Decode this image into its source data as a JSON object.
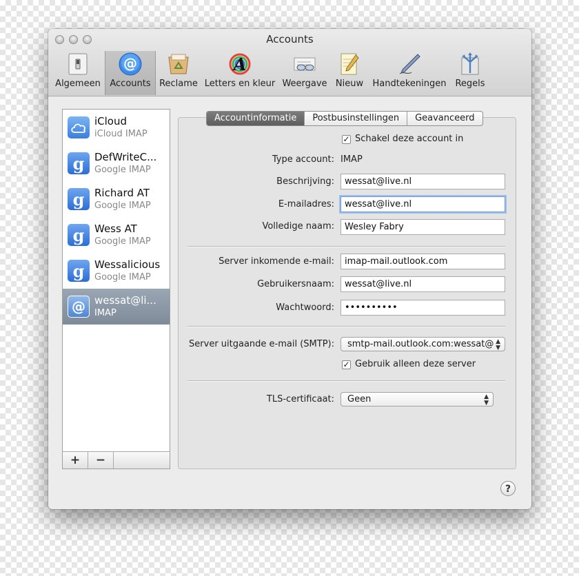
{
  "window": {
    "title": "Accounts"
  },
  "toolbar": [
    {
      "label": "Algemeen",
      "icon": "switch-icon"
    },
    {
      "label": "Accounts",
      "icon": "at-icon"
    },
    {
      "label": "Reclame",
      "icon": "recycle-icon"
    },
    {
      "label": "Letters en kleur",
      "icon": "font-color-icon"
    },
    {
      "label": "Weergave",
      "icon": "glasses-icon"
    },
    {
      "label": "Nieuw",
      "icon": "notepad-icon"
    },
    {
      "label": "Handtekeningen",
      "icon": "pen-icon"
    },
    {
      "label": "Regels",
      "icon": "rules-icon"
    }
  ],
  "accounts": [
    {
      "name": "iCloud",
      "type": "iCloud IMAP",
      "icon": "cloud-icon"
    },
    {
      "name": "DefWriteC...",
      "type": "Google IMAP",
      "icon": "google-icon"
    },
    {
      "name": "Richard AT",
      "type": "Google IMAP",
      "icon": "google-icon"
    },
    {
      "name": "Wess AT",
      "type": "Google IMAP",
      "icon": "google-icon"
    },
    {
      "name": "Wessalicious",
      "type": "Google IMAP",
      "icon": "google-icon"
    },
    {
      "name": "wessat@li...",
      "type": "IMAP",
      "icon": "at-icon"
    }
  ],
  "sidebar_buttons": {
    "add": "+",
    "remove": "−"
  },
  "tabs": [
    "Accountinformatie",
    "Postbusinstellingen",
    "Geavanceerd"
  ],
  "form": {
    "enable_label": "Schakel deze account in",
    "type_label": "Type account:",
    "type_value": "IMAP",
    "description_label": "Beschrijving:",
    "description_value": "wessat@live.nl",
    "email_label": "E-mailadres:",
    "email_value": "wessat@live.nl",
    "fullname_label": "Volledige naam:",
    "fullname_value": "Wesley Fabry",
    "incoming_label": "Server inkomende e-mail:",
    "incoming_value": "imap-mail.outlook.com",
    "username_label": "Gebruikersnaam:",
    "username_value": "wessat@live.nl",
    "password_label": "Wachtwoord:",
    "password_value": "••••••••••",
    "smtp_label": "Server uitgaande e-mail (SMTP):",
    "smtp_value": "smtp-mail.outlook.com:wessat@",
    "only_server_label": "Gebruik alleen deze server",
    "tls_label": "TLS-certificaat:",
    "tls_value": "Geen"
  },
  "help": "?"
}
